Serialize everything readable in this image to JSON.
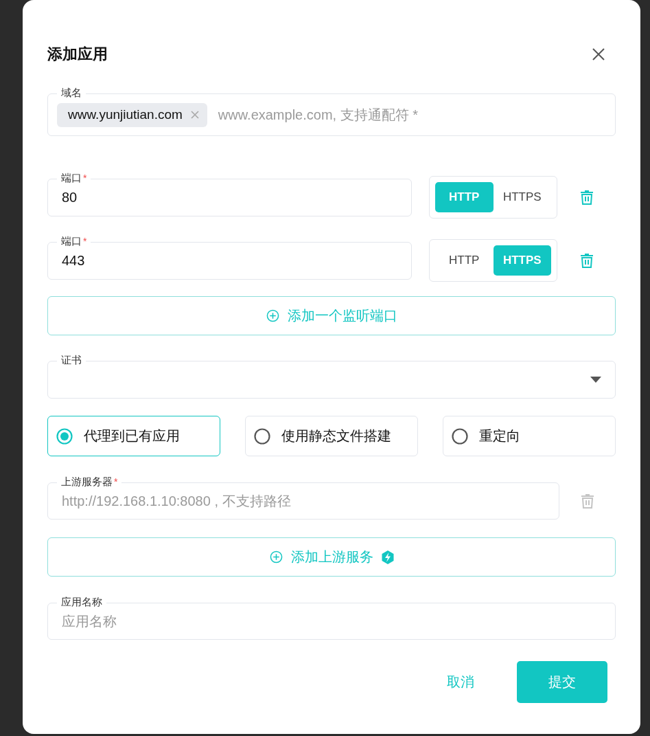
{
  "dialog": {
    "title": "添加应用"
  },
  "domain": {
    "label": "域名",
    "tags": [
      "www.yunjiutian.com"
    ],
    "placeholder": "www.example.com, 支持通配符 *"
  },
  "ports": [
    {
      "label": "端口",
      "required_mark": "*",
      "value": "80",
      "delete_disabled": false,
      "protocols": [
        {
          "label": "HTTP",
          "selected": true
        },
        {
          "label": "HTTPS",
          "selected": false
        }
      ]
    },
    {
      "label": "端口",
      "required_mark": "*",
      "value": "443",
      "delete_disabled": false,
      "protocols": [
        {
          "label": "HTTP",
          "selected": false
        },
        {
          "label": "HTTPS",
          "selected": true
        }
      ]
    }
  ],
  "add_port_button": {
    "label": "添加一个监听端口"
  },
  "certificate": {
    "label": "证书"
  },
  "modes": [
    {
      "label": "代理到已有应用",
      "selected": true
    },
    {
      "label": "使用静态文件搭建",
      "selected": false
    },
    {
      "label": "重定向",
      "selected": false
    }
  ],
  "upstreams": [
    {
      "label": "上游服务器",
      "required_mark": "*",
      "placeholder": "http://192.168.1.10:8080 , 不支持路径",
      "delete_disabled": true
    }
  ],
  "add_upstream_button": {
    "label": "添加上游服务"
  },
  "app_name": {
    "label": "应用名称",
    "placeholder": "应用名称"
  },
  "buttons": [
    {
      "label": "取消",
      "kind": "text"
    },
    {
      "label": "提交",
      "kind": "primary"
    }
  ]
}
